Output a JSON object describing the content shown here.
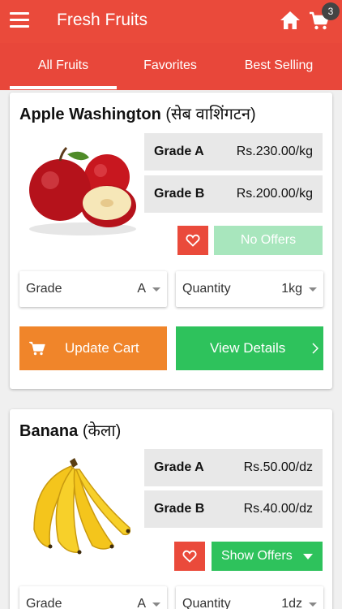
{
  "appbar": {
    "title": "Fresh Fruits",
    "cart_count": "3"
  },
  "tabs": [
    {
      "label": "All Fruits",
      "active": true
    },
    {
      "label": "Favorites",
      "active": false
    },
    {
      "label": "Best Selling",
      "active": false
    }
  ],
  "products": [
    {
      "name": "Apple Washington",
      "name_local": "(सेब वाशिंगटन)",
      "prices": [
        {
          "grade": "Grade A",
          "price": "Rs.230.00/kg"
        },
        {
          "grade": "Grade B",
          "price": "Rs.200.00/kg"
        }
      ],
      "offer_label": "No Offers",
      "grade_label": "Grade",
      "grade_value": "A",
      "quantity_label": "Quantity",
      "quantity_value": "1kg",
      "update_cart_label": "Update Cart",
      "view_details_label": "View Details"
    },
    {
      "name": "Banana",
      "name_local": "(केला)",
      "prices": [
        {
          "grade": "Grade A",
          "price": "Rs.50.00/dz"
        },
        {
          "grade": "Grade B",
          "price": "Rs.40.00/dz"
        }
      ],
      "offer_label": "Show Offers",
      "grade_label": "Grade",
      "grade_value": "A",
      "quantity_label": "Quantity",
      "quantity_value": "1dz"
    }
  ],
  "colors": {
    "primary": "#ea4a3b",
    "accent_green": "#2ec25c",
    "accent_orange": "#f0852a",
    "no_offers_green": "#a8e6bd"
  }
}
